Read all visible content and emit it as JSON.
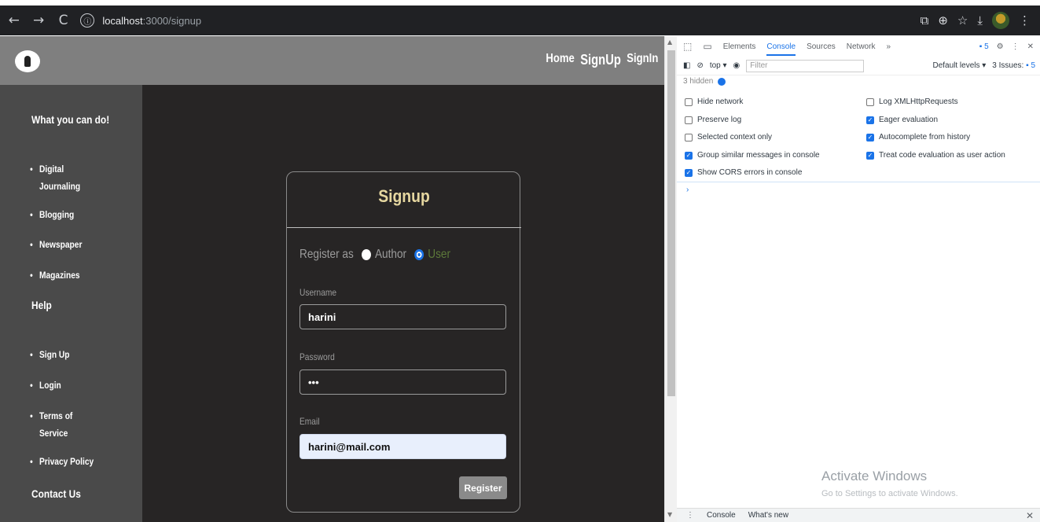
{
  "browser": {
    "url_host": "localhost",
    "url_path": ":3000/signup",
    "back": "←",
    "forward": "→",
    "reload": "C",
    "info": "ⓘ"
  },
  "site": {
    "nav": [
      "Home",
      "SignUp",
      "SignIn"
    ],
    "sidebar": {
      "heading1": "What you can do!",
      "items1": [
        "Digital Journaling",
        "Blogging",
        "Newspaper",
        "Magazines"
      ],
      "heading2": "Help",
      "items2": [
        "Sign Up",
        "Login",
        "Terms of Service",
        "Privacy Policy"
      ],
      "heading3": "Contact Us"
    },
    "form": {
      "title": "Signup",
      "register_as": "Register as",
      "option_author": "Author",
      "option_user": "User",
      "selected": "User",
      "username_label": "Username",
      "username_value": "harini",
      "password_label": "Password",
      "password_value": "•••",
      "email_label": "Email",
      "email_value": "harini@mail.com",
      "submit": "Register"
    }
  },
  "devtools": {
    "tabs": [
      "Elements",
      "Console",
      "Sources",
      "Network",
      "»"
    ],
    "active_tab": "Console",
    "issues_badge": "5",
    "context": "top ▾",
    "filter_placeholder": "Filter",
    "levels": "Default levels ▾",
    "issues_text": "3 Issues:",
    "issues_count": "5",
    "hidden_text": "3 hidden",
    "options_left": [
      {
        "label": "Hide network",
        "checked": false
      },
      {
        "label": "Preserve log",
        "checked": false
      },
      {
        "label": "Selected context only",
        "checked": false
      },
      {
        "label": "Group similar messages in console",
        "checked": true
      },
      {
        "label": "Show CORS errors in console",
        "checked": true
      }
    ],
    "options_right": [
      {
        "label": "Log XMLHttpRequests",
        "checked": false
      },
      {
        "label": "Eager evaluation",
        "checked": true
      },
      {
        "label": "Autocomplete from history",
        "checked": true
      },
      {
        "label": "Treat code evaluation as user action",
        "checked": true
      }
    ],
    "prompt": "›",
    "activate_title": "Activate Windows",
    "activate_sub": "Go to Settings to activate Windows.",
    "drawer_tabs": [
      "Console",
      "What's new"
    ]
  }
}
